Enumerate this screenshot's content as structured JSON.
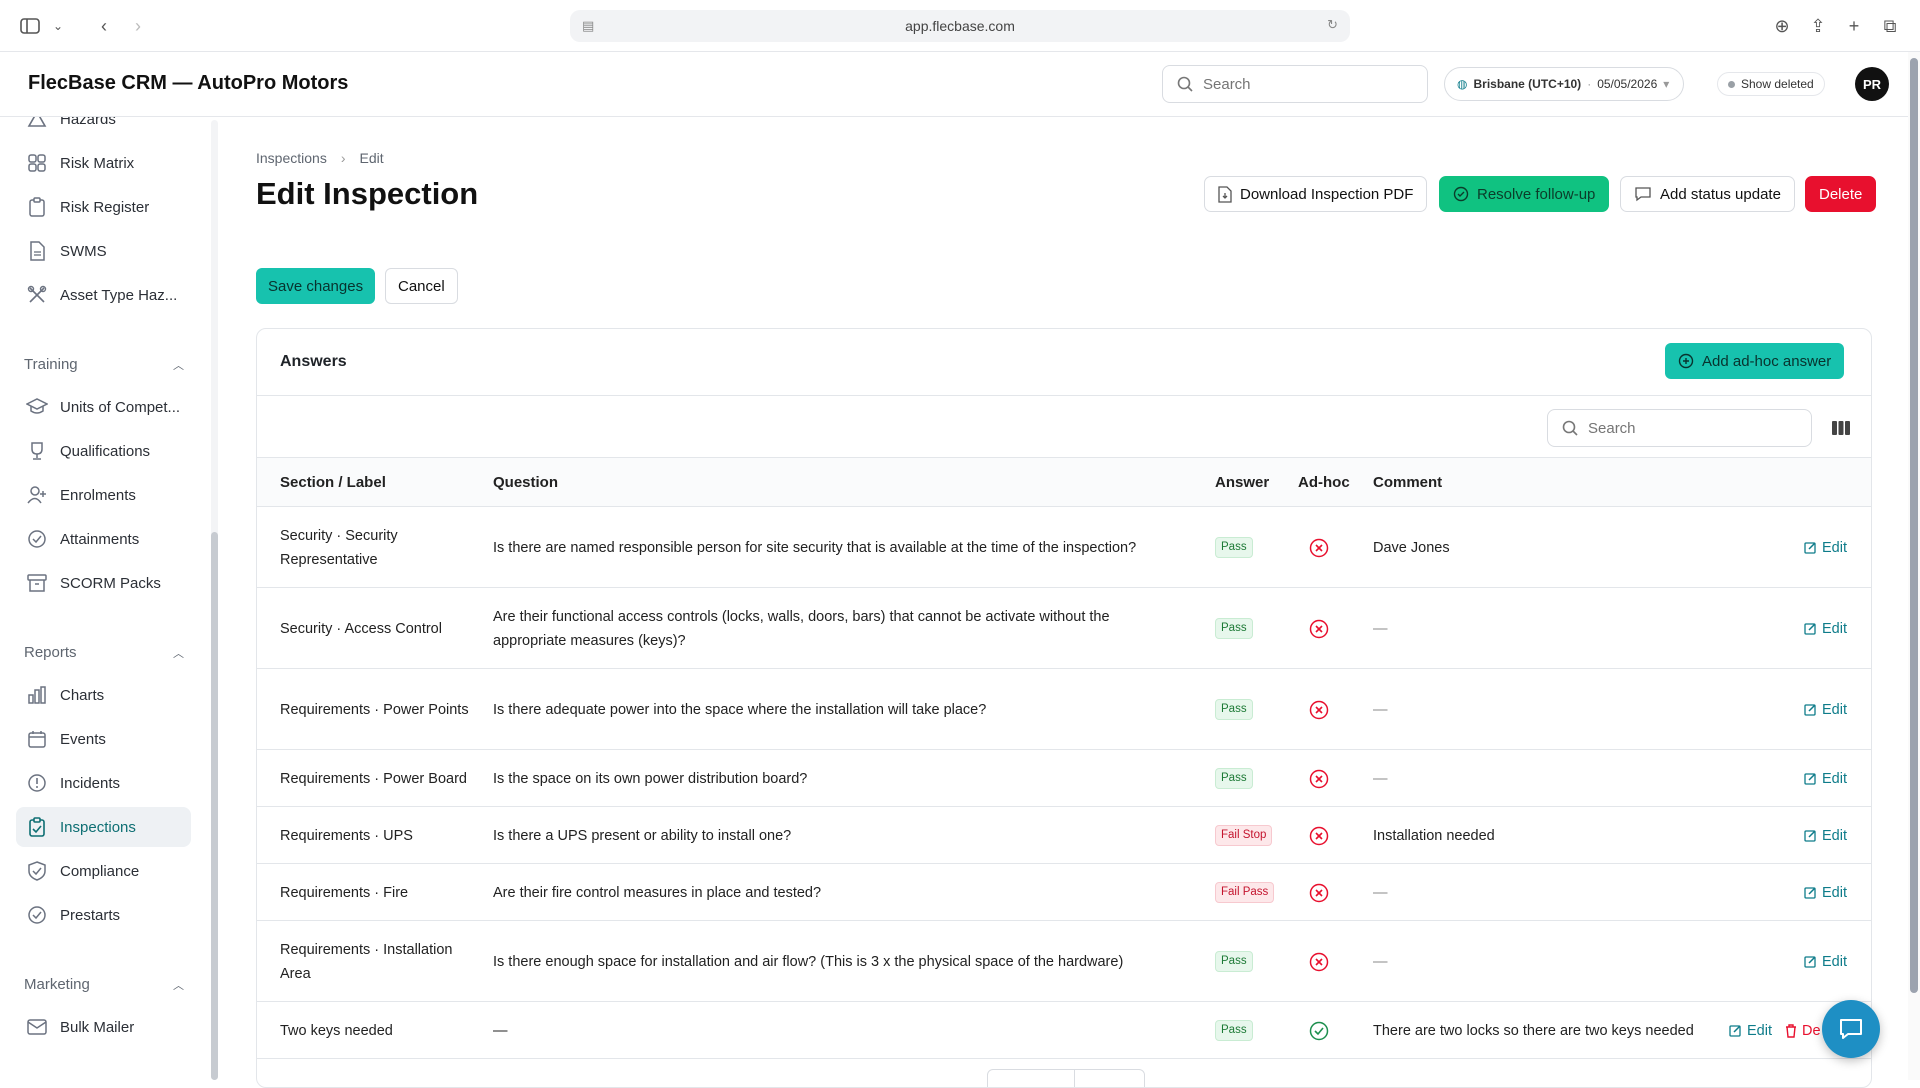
{
  "browser": {
    "url": "app.flecbase.com"
  },
  "header": {
    "app_title": "FlecBase CRM — AutoPro Motors",
    "search_placeholder": "Search",
    "timezone": "Brisbane (UTC+10)",
    "date": "05/05/2026",
    "show_deleted": "Show deleted",
    "avatar_initials": "PR"
  },
  "sidebar": {
    "top_items": [
      {
        "label": "Hazards",
        "icon": "warning-icon"
      },
      {
        "label": "Risk Matrix",
        "icon": "grid-icon"
      },
      {
        "label": "Risk Register",
        "icon": "clipboard-icon"
      },
      {
        "label": "SWMS",
        "icon": "document-icon"
      },
      {
        "label": "Asset Type Haz...",
        "icon": "tools-icon"
      }
    ],
    "training": {
      "title": "Training",
      "items": [
        {
          "label": "Units of Compet...",
          "icon": "graduation-cap-icon"
        },
        {
          "label": "Qualifications",
          "icon": "trophy-icon"
        },
        {
          "label": "Enrolments",
          "icon": "user-plus-icon"
        },
        {
          "label": "Attainments",
          "icon": "check-circle-icon"
        },
        {
          "label": "SCORM Packs",
          "icon": "archive-icon"
        }
      ]
    },
    "reports": {
      "title": "Reports",
      "items": [
        {
          "label": "Charts",
          "icon": "bar-chart-icon"
        },
        {
          "label": "Events",
          "icon": "calendar-icon"
        },
        {
          "label": "Incidents",
          "icon": "alert-circle-icon"
        },
        {
          "label": "Inspections",
          "icon": "clipboard-check-icon",
          "active": true
        },
        {
          "label": "Compliance",
          "icon": "shield-check-icon"
        },
        {
          "label": "Prestarts",
          "icon": "check-circle-icon"
        }
      ]
    },
    "marketing": {
      "title": "Marketing",
      "items": [
        {
          "label": "Bulk Mailer",
          "icon": "mail-icon"
        }
      ]
    }
  },
  "breadcrumb": {
    "parent": "Inspections",
    "current": "Edit"
  },
  "page_title": "Edit Inspection",
  "actions": {
    "download_pdf": "Download Inspection PDF",
    "resolve": "Resolve follow-up",
    "add_status": "Add status update",
    "delete": "Delete"
  },
  "form": {
    "save": "Save changes",
    "cancel": "Cancel"
  },
  "answers": {
    "title": "Answers",
    "add_adhoc": "Add ad-hoc answer",
    "search_placeholder": "Search",
    "columns": {
      "section": "Section / Label",
      "question": "Question",
      "answer": "Answer",
      "adhoc": "Ad-hoc",
      "comment": "Comment"
    },
    "edit_label": "Edit",
    "delete_label": "De",
    "rows": [
      {
        "section": "Security · Security Representative",
        "question": "Is there are named responsible person for site security that is available at the time of the inspection?",
        "answer": "Pass",
        "adhoc": false,
        "comment": "Dave Jones"
      },
      {
        "section": "Security · Access Control",
        "question": "Are their functional access controls (locks, walls, doors, bars) that cannot be activate without the appropriate measures (keys)?",
        "answer": "Pass",
        "adhoc": false,
        "comment": "—"
      },
      {
        "section": "Requirements · Power Points",
        "question": "Is there adequate power into the space where the installation will take place?",
        "answer": "Pass",
        "adhoc": false,
        "comment": "—"
      },
      {
        "section": "Requirements · Power Board",
        "question": "Is the space on its own power distribution board?",
        "answer": "Pass",
        "adhoc": false,
        "comment": "—"
      },
      {
        "section": "Requirements · UPS",
        "question": "Is there a UPS present or ability to install one?",
        "answer": "Fail Stop",
        "adhoc": false,
        "comment": "Installation needed"
      },
      {
        "section": "Requirements · Fire",
        "question": "Are their fire control measures in place and tested?",
        "answer": "Fail Pass",
        "adhoc": false,
        "comment": "—"
      },
      {
        "section": "Requirements · Installation Area",
        "question": "Is there enough space for installation and air flow? (This is 3 x the physical space of the hardware)",
        "answer": "Pass",
        "adhoc": false,
        "comment": "—"
      },
      {
        "section": "Two keys needed",
        "question": "—",
        "answer": "Pass",
        "adhoc": true,
        "comment": "There are two locks so there are two keys needed"
      }
    ]
  },
  "colors": {
    "accent": "#17c2ae",
    "green": "#10c281",
    "danger": "#e8102e",
    "link": "#0e7c8a"
  }
}
